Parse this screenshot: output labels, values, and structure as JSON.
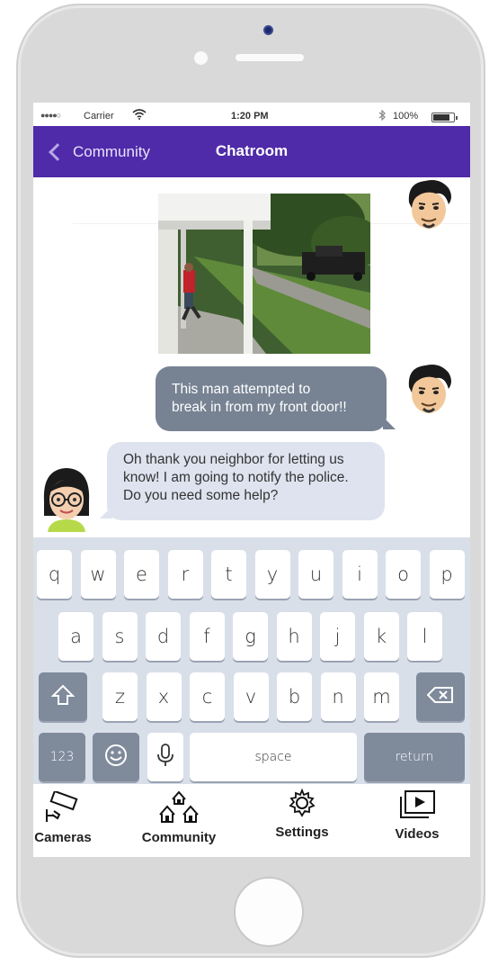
{
  "status_bar": {
    "signal": "●●●●○",
    "carrier": "Carrier",
    "time": "1:20 PM",
    "battery_pct": "100%",
    "battery_level": 0.8
  },
  "nav": {
    "back_label": "Community",
    "title": "Chatroom"
  },
  "messages": [
    {
      "from": "me",
      "type": "image"
    },
    {
      "from": "me",
      "type": "text",
      "lines": [
        "This man attempted to",
        "break in from my front door!!"
      ]
    },
    {
      "from": "neighbor",
      "type": "text",
      "lines": [
        "Oh thank you neighbor for letting us",
        "know! I am going to notify the police.",
        "Do you need some help?"
      ]
    }
  ],
  "keyboard": {
    "row1": [
      "q",
      "w",
      "e",
      "r",
      "t",
      "y",
      "u",
      "i",
      "o",
      "p"
    ],
    "row2": [
      "a",
      "s",
      "d",
      "f",
      "g",
      "h",
      "j",
      "k",
      "l"
    ],
    "row3": [
      "z",
      "x",
      "c",
      "v",
      "b",
      "n",
      "m"
    ],
    "numbers_label": "123",
    "space_label": "space",
    "return_label": "return"
  },
  "tabs": [
    {
      "label": "Cameras",
      "icon": "camera-icon"
    },
    {
      "label": "Community",
      "icon": "houses-icon"
    },
    {
      "label": "Settings",
      "icon": "gear-icon"
    },
    {
      "label": "Videos",
      "icon": "video-play-icon"
    }
  ],
  "colors": {
    "nav_bg": "#4f2aa9",
    "outgoing_bubble": "#778393",
    "incoming_bubble": "#dfe3ef",
    "keyboard_bg": "#d9dfe9"
  }
}
